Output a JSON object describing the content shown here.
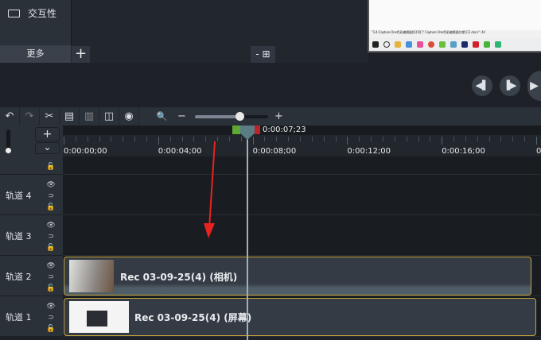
{
  "tools_panel": {
    "interactivity_label": "交互性",
    "more_label": "更多",
    "add_label": "+",
    "layout_label": "- ⊞"
  },
  "preview": {
    "caption": "\"3.4-Capture One色彩编辑器找不到了 Capture One色彩编辑器在哪打开.docx\": 44"
  },
  "playback": {
    "prev_label": "◀▌",
    "next_label": "▐▶",
    "play_label": "▶"
  },
  "toolbar": {
    "undo": "↶",
    "redo": "↷",
    "cut": "✂",
    "copy": "▤",
    "paste": "▥",
    "split": "◫",
    "snapshot": "◉",
    "zoom": "🔍",
    "zoom_out": "−",
    "zoom_in": "+",
    "zoom_level": 0.6
  },
  "timeline": {
    "playhead_time": "0:00:07;23",
    "ruler_labels": [
      "0:00:00;00",
      "0:00:04;00",
      "0:00:08;00",
      "0:00:12;00",
      "0:00:16;00",
      "0"
    ],
    "tracks": [
      {
        "name": "轨道 4"
      },
      {
        "name": "轨道 3"
      },
      {
        "name": "轨道 2"
      },
      {
        "name": "轨道 1"
      }
    ],
    "clips": [
      {
        "title": "Rec 03-09-25(4) (相机)"
      },
      {
        "title": "Rec 03-09-25(4) (屏幕)"
      }
    ],
    "track_add": "+",
    "track_collapse": "⌄"
  },
  "colors": {
    "accent_clip_border": "#c9a53a",
    "annotation_arrow": "#e8231f",
    "in_marker": "#5ea836",
    "out_marker": "#b8262a"
  }
}
